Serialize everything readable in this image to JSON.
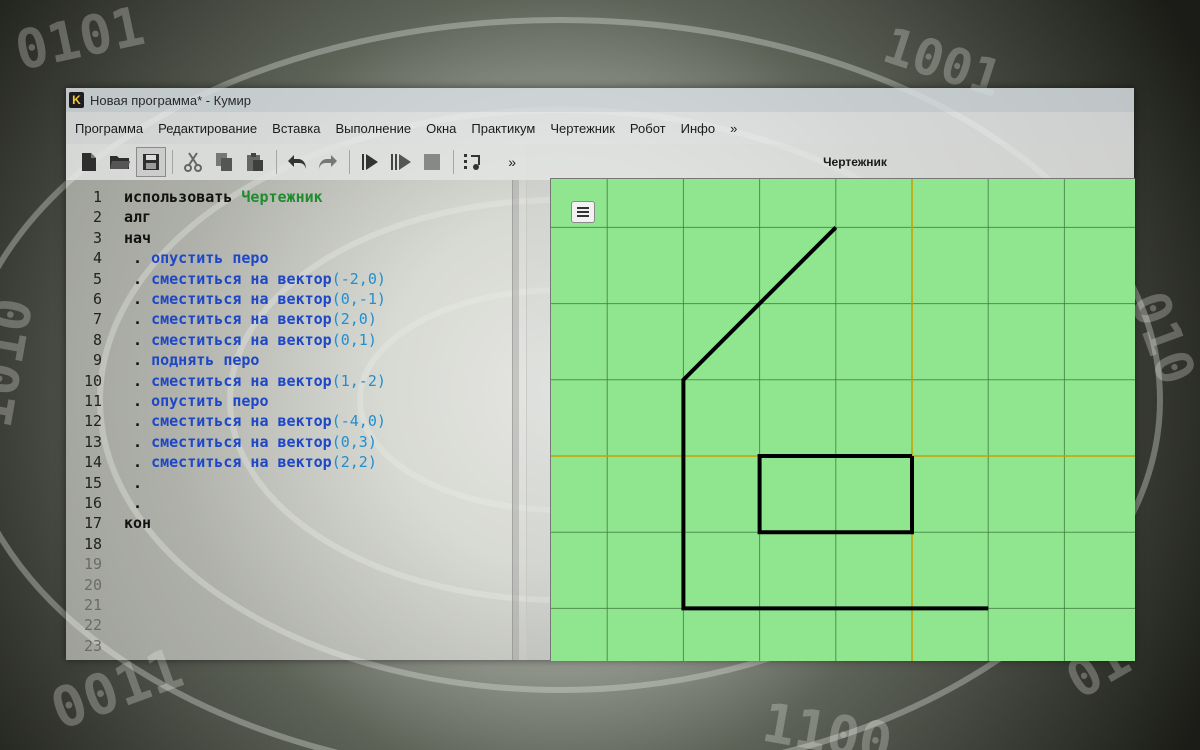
{
  "window": {
    "title": "Новая программа* - Кумир",
    "logo_letter": "K"
  },
  "menu": [
    "Программа",
    "Редактирование",
    "Вставка",
    "Выполнение",
    "Окна",
    "Практикум",
    "Чертежник",
    "Робот",
    "Инфо",
    "»"
  ],
  "toolbar": {
    "buttons": [
      "new-file-icon",
      "open-folder-icon",
      "save-icon",
      "cut-icon",
      "copy-icon",
      "paste-icon",
      "undo-icon",
      "redo-icon",
      "run-icon",
      "step-run-icon",
      "stop-icon",
      "debug-icon"
    ],
    "more": "»"
  },
  "editor": {
    "line_numbers": [
      "1",
      "2",
      "3",
      "4",
      "5",
      "6",
      "7",
      "8",
      "9",
      "10",
      "11",
      "12",
      "13",
      "14",
      "15",
      "16",
      "17",
      "18",
      "19",
      "20",
      "21",
      "22",
      "23"
    ],
    "lines": [
      [
        {
          "t": "использовать ",
          "c": "kw"
        },
        {
          "t": "Чертежник",
          "c": "mod"
        }
      ],
      [
        {
          "t": "алг",
          "c": "kw"
        }
      ],
      [
        {
          "t": "нач",
          "c": "kw"
        }
      ],
      [
        {
          "t": " . ",
          "c": "kw"
        },
        {
          "t": "опустить перо",
          "c": "cmd"
        }
      ],
      [
        {
          "t": " . ",
          "c": "kw"
        },
        {
          "t": "сместиться на вектор",
          "c": "cmd"
        },
        {
          "t": "(-2,0)",
          "c": "num"
        }
      ],
      [
        {
          "t": " . ",
          "c": "kw"
        },
        {
          "t": "сместиться на вектор",
          "c": "cmd"
        },
        {
          "t": "(0,-1)",
          "c": "num"
        }
      ],
      [
        {
          "t": " . ",
          "c": "kw"
        },
        {
          "t": "сместиться на вектор",
          "c": "cmd"
        },
        {
          "t": "(2,0)",
          "c": "num"
        }
      ],
      [
        {
          "t": " . ",
          "c": "kw"
        },
        {
          "t": "сместиться на вектор",
          "c": "cmd"
        },
        {
          "t": "(0,1)",
          "c": "num"
        }
      ],
      [
        {
          "t": " . ",
          "c": "kw"
        },
        {
          "t": "поднять перо",
          "c": "cmd"
        }
      ],
      [
        {
          "t": " . ",
          "c": "kw"
        },
        {
          "t": "сместиться на вектор",
          "c": "cmd"
        },
        {
          "t": "(1,-2)",
          "c": "num"
        }
      ],
      [
        {
          "t": " . ",
          "c": "kw"
        },
        {
          "t": "опустить перо",
          "c": "cmd"
        }
      ],
      [
        {
          "t": " . ",
          "c": "kw"
        },
        {
          "t": "сместиться на вектор",
          "c": "cmd"
        },
        {
          "t": "(-4,0)",
          "c": "num"
        }
      ],
      [
        {
          "t": " . ",
          "c": "kw"
        },
        {
          "t": "сместиться на вектор",
          "c": "cmd"
        },
        {
          "t": "(0,3)",
          "c": "num"
        }
      ],
      [
        {
          "t": " . ",
          "c": "kw"
        },
        {
          "t": "сместиться на вектор",
          "c": "cmd"
        },
        {
          "t": "(2,2)",
          "c": "num"
        }
      ],
      [
        {
          "t": " .",
          "c": "kw"
        }
      ],
      [
        {
          "t": " .",
          "c": "kw"
        }
      ],
      [
        {
          "t": "кон",
          "c": "kw"
        }
      ],
      [],
      [],
      [],
      [],
      [],
      []
    ]
  },
  "drawer": {
    "title": "Чертежник",
    "menu_button_icon": "hamburger-menu-icon",
    "colors": {
      "background": "#8fe68f",
      "grid": "#3f7a3f",
      "axis": "#c8a000",
      "pen": "#000000"
    },
    "strokes": [
      [
        [
          0,
          0
        ],
        [
          -2,
          0
        ],
        [
          -2,
          -1
        ],
        [
          0,
          -1
        ],
        [
          0,
          0
        ]
      ],
      [
        [
          1,
          -2
        ],
        [
          -3,
          -2
        ],
        [
          -3,
          1
        ],
        [
          -1,
          3
        ]
      ]
    ]
  }
}
